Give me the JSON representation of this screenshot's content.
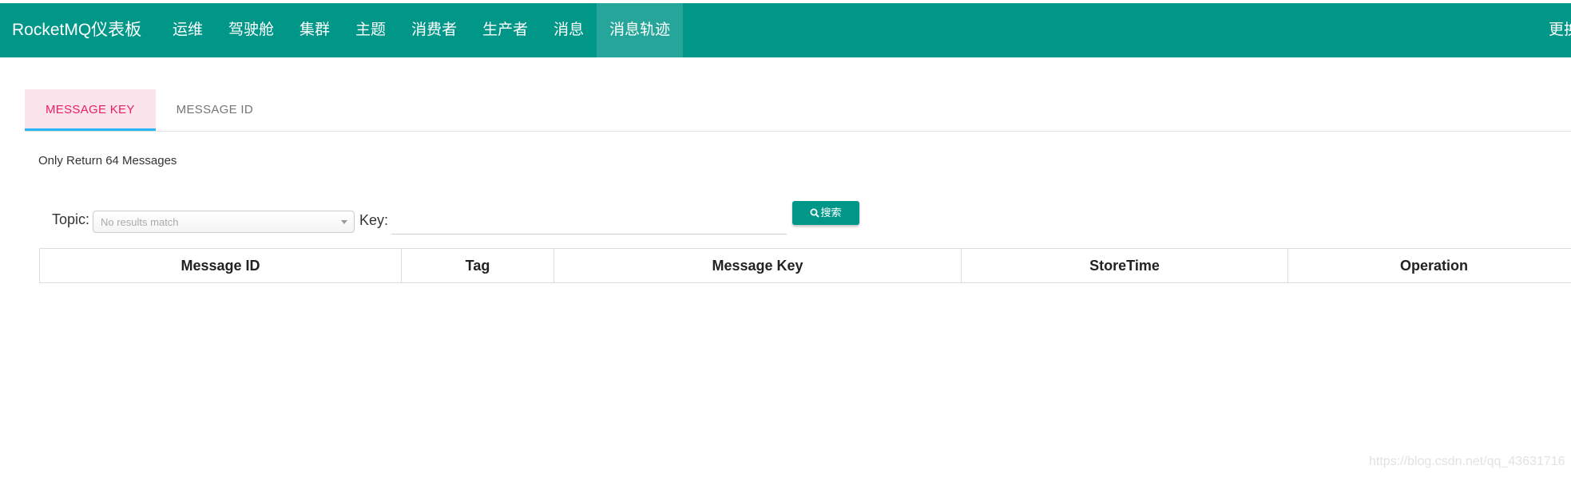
{
  "navbar": {
    "brand": "RocketMQ仪表板",
    "items": [
      {
        "label": "运维"
      },
      {
        "label": "驾驶舱"
      },
      {
        "label": "集群"
      },
      {
        "label": "主题"
      },
      {
        "label": "消费者"
      },
      {
        "label": "生产者"
      },
      {
        "label": "消息"
      },
      {
        "label": "消息轨迹"
      }
    ],
    "active_item": "消息轨迹",
    "right_label": "更换"
  },
  "tabs": [
    {
      "label": "MESSAGE KEY",
      "active": true
    },
    {
      "label": "MESSAGE ID",
      "active": false
    }
  ],
  "note": "Only Return 64 Messages",
  "search": {
    "topic_label": "Topic:",
    "topic_placeholder": "No results match",
    "key_label": "Key:",
    "key_value": "",
    "button_label": "搜索",
    "button_icon": "search-icon"
  },
  "table": {
    "columns": [
      "Message ID",
      "Tag",
      "Message Key",
      "StoreTime",
      "Operation"
    ],
    "rows": []
  },
  "watermark": "https://blog.csdn.net/qq_43631716",
  "colors": {
    "primary": "#009688",
    "active_nav": "#26a69a",
    "tab_active_bg": "#fce4ec",
    "tab_active_text": "#e91e63",
    "tab_indicator": "#29b6f6"
  }
}
